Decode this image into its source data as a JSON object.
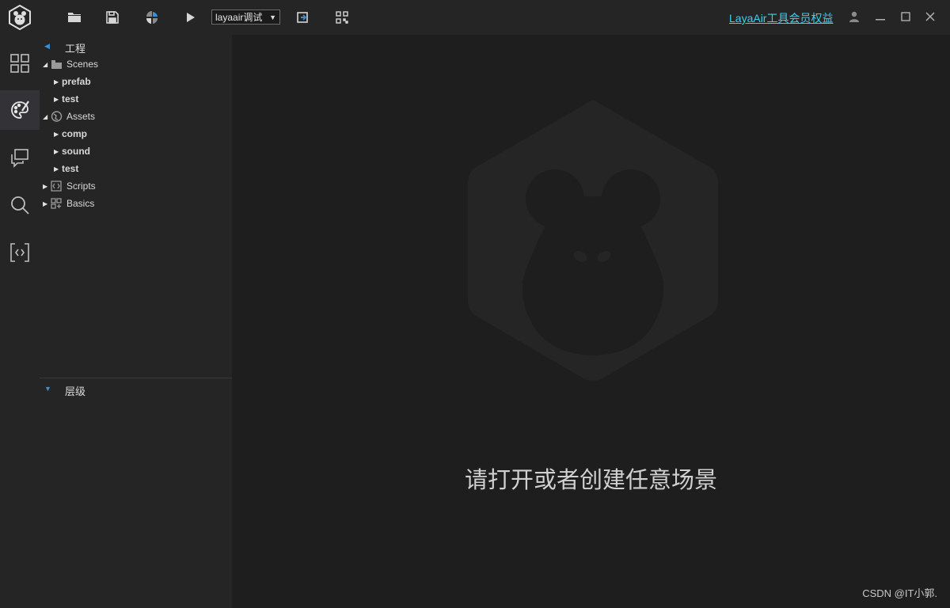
{
  "toolbar": {
    "target_select": "layaair调试",
    "member_link": "LayaAir工具会员权益"
  },
  "activity": {
    "items": [
      "grid-icon",
      "palette-icon",
      "chat-icon",
      "search-icon",
      "code-icon"
    ],
    "active": "palette-icon"
  },
  "project_panel": {
    "title": "工程",
    "tree": {
      "scenes": {
        "label": "Scenes",
        "children": [
          "prefab",
          "test"
        ]
      },
      "assets": {
        "label": "Assets",
        "children": [
          "comp",
          "sound",
          "test"
        ]
      },
      "scripts": {
        "label": "Scripts"
      },
      "basics": {
        "label": "Basics"
      }
    }
  },
  "hierarchy_panel": {
    "title": "层级"
  },
  "main": {
    "hint": "请打开或者创建任意场景"
  },
  "watermark": "CSDN @IT小郭.",
  "colors": {
    "accent": "#3ad0f0",
    "toggle": "#3a8fd6",
    "bg": "#1e1e1e",
    "panel": "#252526"
  }
}
